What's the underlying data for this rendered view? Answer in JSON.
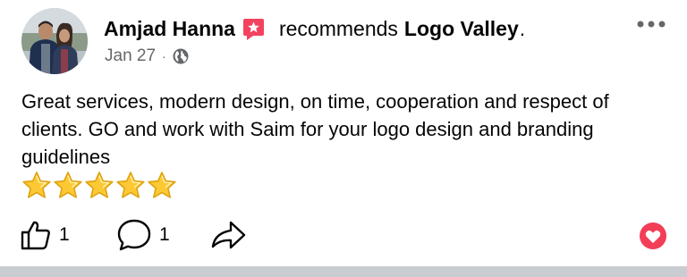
{
  "post": {
    "author_name": "Amjad Hanna",
    "recommends_text": "recommends",
    "page_name": "Logo Valley",
    "period": ".",
    "date": "Jan 27",
    "dot": "·",
    "audience_icon": "globe-icon",
    "more_icon": "more-dots-icon",
    "text": "Great services, modern design, on time, cooperation and respect of clients. GO and work with Saim for your logo design and branding guidelines",
    "rating": {
      "stars": 5,
      "max": 5
    }
  },
  "actions": {
    "like_count": "1",
    "comment_count": "1",
    "like_icon": "thumbs-up-icon",
    "comment_icon": "comment-bubble-icon",
    "share_icon": "share-arrow-icon",
    "reaction_icon": "love-heart-icon"
  },
  "colors": {
    "text_primary": "#050505",
    "text_secondary": "#65676b",
    "recommend_badge": "#f3425f",
    "heart_reaction": "#f33e58",
    "star_fill": "#fcc934",
    "divider": "#c9ccd1"
  }
}
